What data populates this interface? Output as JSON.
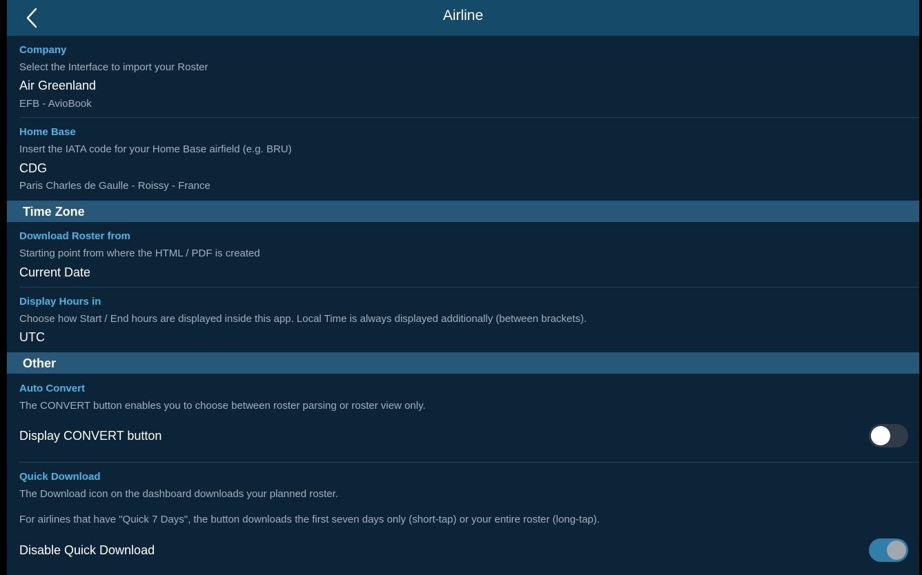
{
  "header": {
    "title": "Airline"
  },
  "company": {
    "title": "Company",
    "description": "Select the Interface to import your Roster",
    "value": "Air Greenland",
    "sub_value": "EFB - AvioBook"
  },
  "home_base": {
    "title": "Home Base",
    "description": "Insert the IATA code for your Home Base airfield (e.g. BRU)",
    "value": "CDG",
    "sub_value": "Paris Charles de Gaulle - Roissy - France"
  },
  "time_zone": {
    "header": "Time Zone",
    "download_from": {
      "title": "Download Roster from",
      "description": "Starting point from where the HTML / PDF is created",
      "value": "Current Date"
    },
    "display_hours": {
      "title": "Display Hours in",
      "description": "Choose how Start / End hours are displayed inside this app.  Local Time is always displayed additionally (between brackets).",
      "value": "UTC"
    }
  },
  "other": {
    "header": "Other",
    "auto_convert": {
      "title": "Auto Convert",
      "description": "The CONVERT button enables you to choose between roster parsing or roster view only.",
      "toggle_label": "Display CONVERT button",
      "toggle_on": false
    },
    "quick_download": {
      "title": "Quick Download",
      "description": "The Download icon on the dashboard downloads your planned roster.",
      "description2": "For airlines that have \"Quick 7 Days\", the button downloads the first seven days only (short-tap) or your entire roster (long-tap).",
      "toggle_label": "Disable Quick Download",
      "toggle_on": true
    }
  },
  "icons": {
    "back": "chevron-left-icon"
  },
  "colors": {
    "background": "#0c2438",
    "navbar": "#164a69",
    "section_header": "#275878",
    "accent": "#4ab4e6",
    "toggle_on": "#2f7fa8"
  }
}
